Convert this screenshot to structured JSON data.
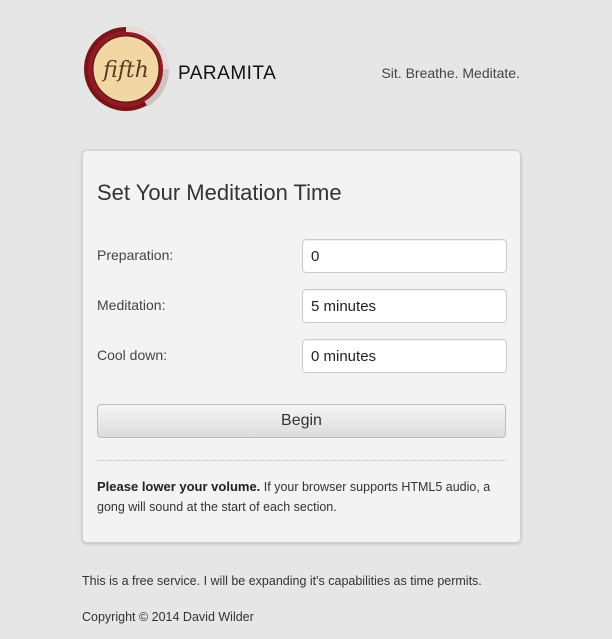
{
  "header": {
    "logo_text": "fifth",
    "brand": "PARAMITA",
    "tagline": "Sit. Breathe. Meditate."
  },
  "form": {
    "title": "Set Your Meditation Time",
    "fields": [
      {
        "label": "Preparation:",
        "value": "0"
      },
      {
        "label": "Meditation:",
        "value": "5 minutes"
      },
      {
        "label": "Cool down:",
        "value": "0 minutes"
      }
    ],
    "begin_label": "Begin",
    "notice_bold": "Please lower your volume.",
    "notice_text": " If your browser supports HTML5 audio, a gong will sound at the start of each section."
  },
  "footer": {
    "service_note": "This is a free service. I will be expanding it's capabilities as time permits.",
    "copyright": "Copyright © 2014 David Wilder"
  },
  "colors": {
    "logo_ring": "#7a1419",
    "logo_fill": "#f2d7a5",
    "background": "#e6e6e6"
  }
}
